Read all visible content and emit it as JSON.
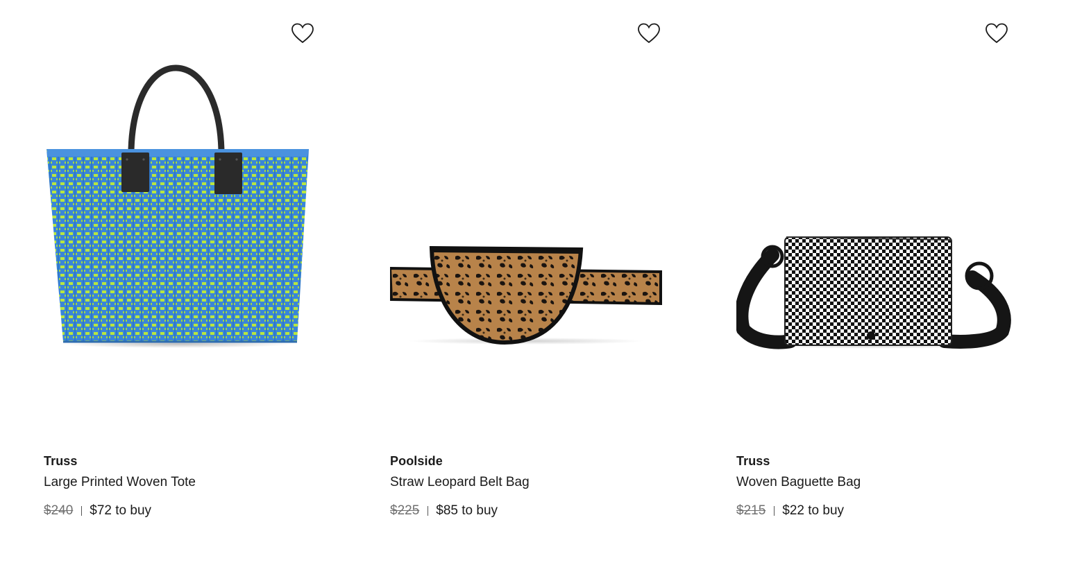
{
  "products": [
    {
      "brand": "Truss",
      "name": "Large Printed Woven Tote",
      "retail_price": "$240",
      "buy_price": "$72 to buy",
      "image": "blue-green-woven-tote",
      "colors": {
        "primary": "#3a86d8",
        "secondary": "#b8e640",
        "handles": "#2b2b2b"
      }
    },
    {
      "brand": "Poolside",
      "name": "Straw Leopard Belt Bag",
      "retail_price": "$225",
      "buy_price": "$85 to buy",
      "image": "leopard-belt-bag",
      "colors": {
        "primary": "#b8834a",
        "secondary": "#1a1410",
        "trim": "#111111"
      }
    },
    {
      "brand": "Truss",
      "name": "Woven Baguette Bag",
      "retail_price": "$215",
      "buy_price": "$22 to buy",
      "image": "black-white-checker-baguette",
      "colors": {
        "primary": "#ffffff",
        "secondary": "#111111",
        "strap": "#151515"
      }
    }
  ],
  "icons": {
    "favorite": "heart-outline-icon"
  }
}
